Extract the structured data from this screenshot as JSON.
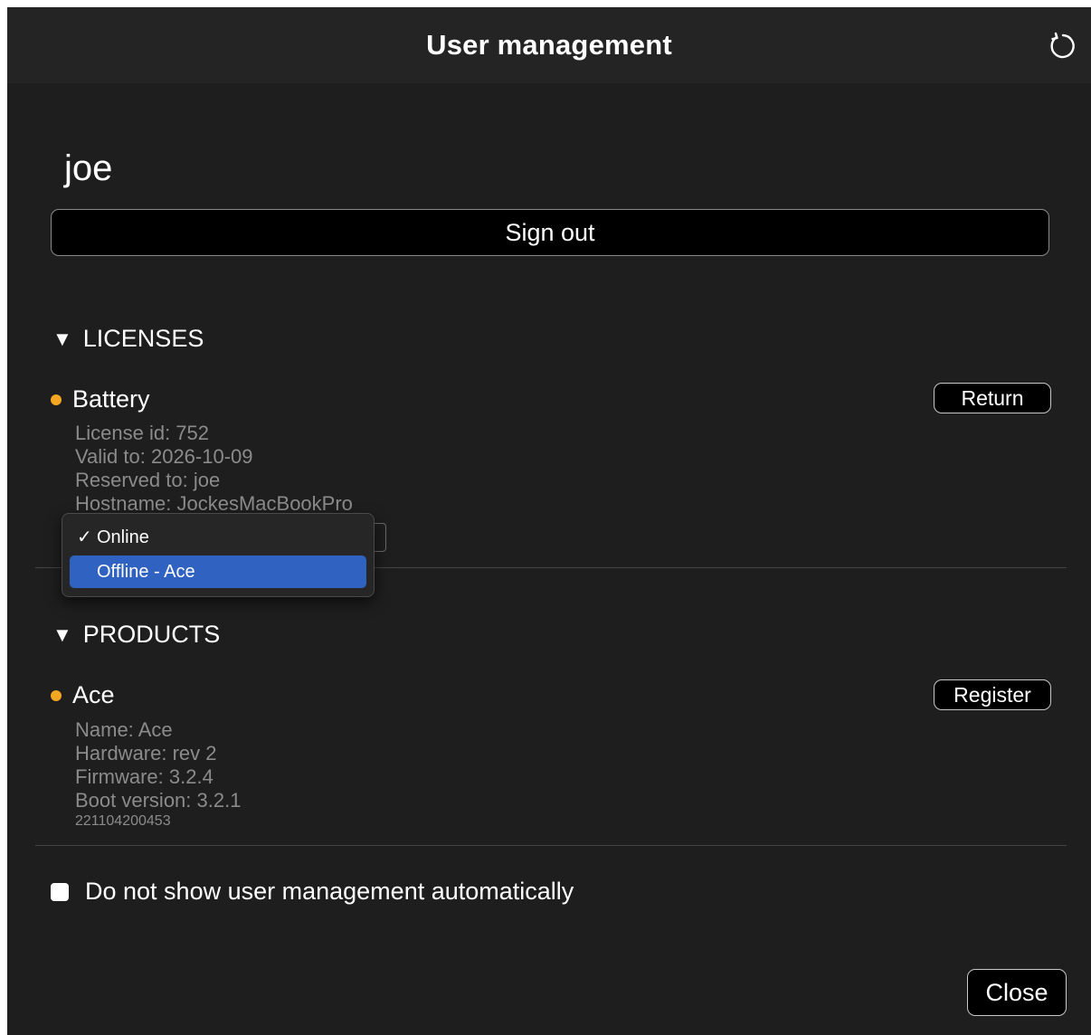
{
  "header": {
    "title": "User management",
    "refresh_icon": "refresh-icon"
  },
  "user": {
    "name": "joe",
    "signout_label": "Sign out"
  },
  "licenses": {
    "heading": "LICENSES",
    "collapse_icon": "▼",
    "item": {
      "name": "Battery",
      "status_color": "#f5a623",
      "action_label": "Return",
      "details": [
        "License id: 752",
        "Valid to: 2026-10-09",
        "Reserved to: joe",
        "Hostname: JockesMacBookPro"
      ],
      "mode_options": [
        {
          "label": "Online",
          "checked": true,
          "highlighted": false
        },
        {
          "label": "Offline - Ace",
          "checked": false,
          "highlighted": true
        }
      ]
    }
  },
  "products": {
    "heading": "PRODUCTS",
    "collapse_icon": "▼",
    "item": {
      "name": "Ace",
      "status_color": "#f5a623",
      "action_label": "Register",
      "details": [
        "Name: Ace",
        "Hardware: rev 2",
        "Firmware: 3.2.4",
        "Boot version: 3.2.1"
      ],
      "serial": "221104200453"
    }
  },
  "footer": {
    "checkbox_label": "Do not show user management automatically",
    "checkbox_checked": false,
    "close_label": "Close"
  },
  "colors": {
    "background": "#1e1e1e",
    "titlebar": "#242424",
    "highlight": "#2f62c1",
    "muted_text": "#8b8b8b",
    "status_dot": "#f5a623"
  }
}
